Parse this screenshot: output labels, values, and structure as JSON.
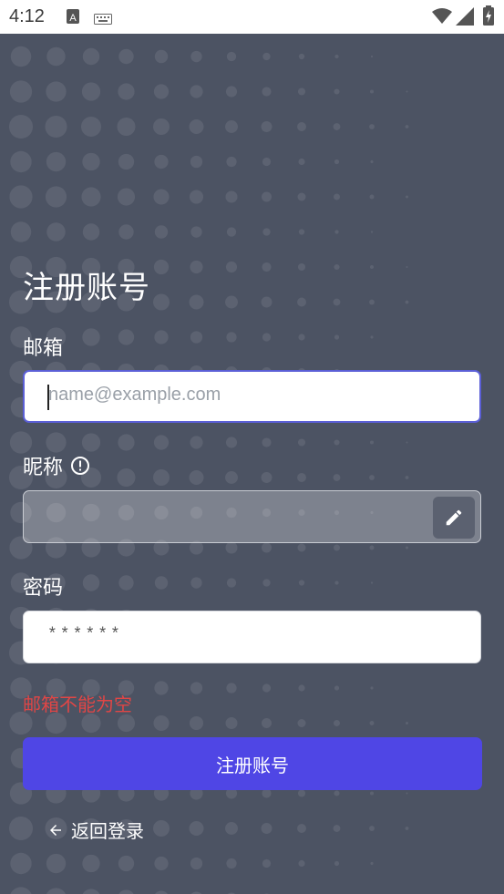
{
  "status_bar": {
    "time": "4:12"
  },
  "page": {
    "title": "注册账号",
    "email": {
      "label": "邮箱",
      "placeholder": "name@example.com",
      "value": ""
    },
    "nickname": {
      "label": "昵称",
      "value": ""
    },
    "password": {
      "label": "密码",
      "value": "******"
    },
    "error_message": "邮箱不能为空",
    "submit_label": "注册账号",
    "back_label": "返回登录"
  },
  "colors": {
    "background": "#4c5363",
    "accent": "#4f46e5",
    "error": "#e04646",
    "focus_border": "#5b5fd6"
  },
  "icons": {
    "info": "info-icon",
    "edit": "pencil-icon",
    "back": "arrow-left-icon"
  }
}
